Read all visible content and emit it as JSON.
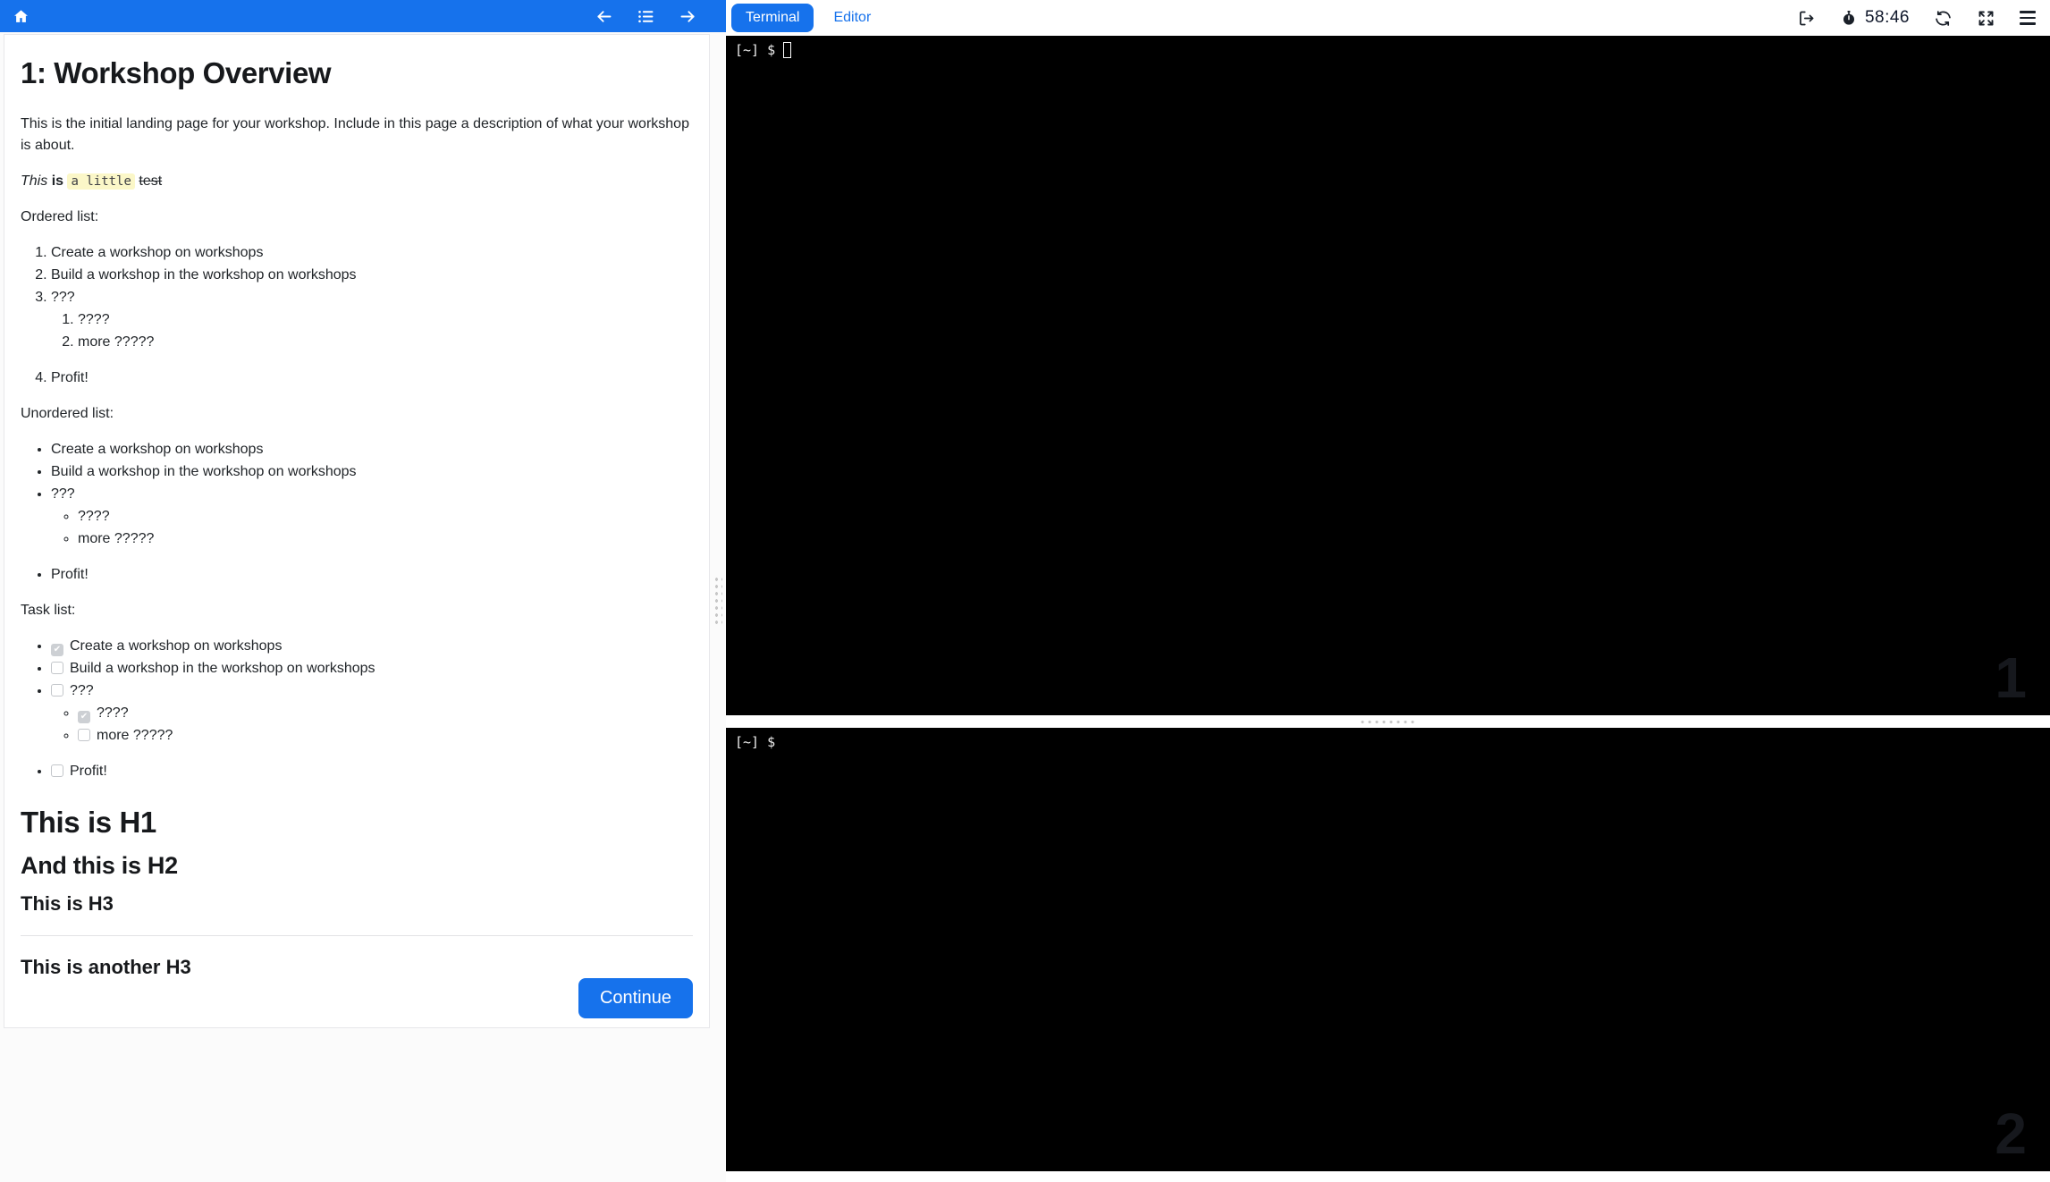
{
  "colors": {
    "accent": "#1672ec",
    "terminal_background": "#000000",
    "inline_code_background": "#fbf7c8",
    "watermark_color": "#16181d"
  },
  "doc_header": {
    "home_icon": "home",
    "back_icon": "arrow-left",
    "toc_icon": "list-toc",
    "forward_icon": "arrow-right"
  },
  "doc": {
    "title": "1: Workshop Overview",
    "intro": "This is the initial landing page for your workshop. Include in this page a description of what your workshop is about.",
    "styled": {
      "italic": "This",
      "bold": "is",
      "code": "a little",
      "strike": "test"
    },
    "ordered_label": "Ordered list:",
    "ol": [
      "Create a workshop on workshops",
      "Build a workshop in the workshop on workshops",
      "???",
      "Profit!"
    ],
    "ol_sub": [
      "????",
      "more ?????"
    ],
    "unordered_label": "Unordered list:",
    "ul": [
      "Create a workshop on workshops",
      "Build a workshop in the workshop on workshops",
      "???",
      "Profit!"
    ],
    "ul_sub": [
      "????",
      "more ?????"
    ],
    "task_label": "Task list:",
    "tasks": [
      {
        "label": "Create a workshop on workshops",
        "checked": true
      },
      {
        "label": "Build a workshop in the workshop on workshops",
        "checked": false
      },
      {
        "label": "???",
        "checked": false
      },
      {
        "label": "Profit!",
        "checked": false
      }
    ],
    "tasks_sub": [
      {
        "label": "????",
        "checked": true
      },
      {
        "label": "more ?????",
        "checked": false
      }
    ],
    "h1": "This is H1",
    "h2": "And this is H2",
    "h3": "This is H3",
    "h3_b": "This is another H3",
    "continue_label": "Continue"
  },
  "workspace": {
    "tabs": [
      {
        "label": "Terminal",
        "active": true
      },
      {
        "label": "Editor",
        "active": false
      }
    ],
    "toolbar": {
      "timer": "58:46",
      "icons": [
        "sign-out",
        "stopwatch",
        "refresh",
        "fullscreen",
        "menu"
      ]
    },
    "terminals": [
      {
        "prompt": "[~] $",
        "watermark": "1",
        "has_cursor": true
      },
      {
        "prompt": "[~] $",
        "watermark": "2",
        "has_cursor": false
      }
    ]
  }
}
